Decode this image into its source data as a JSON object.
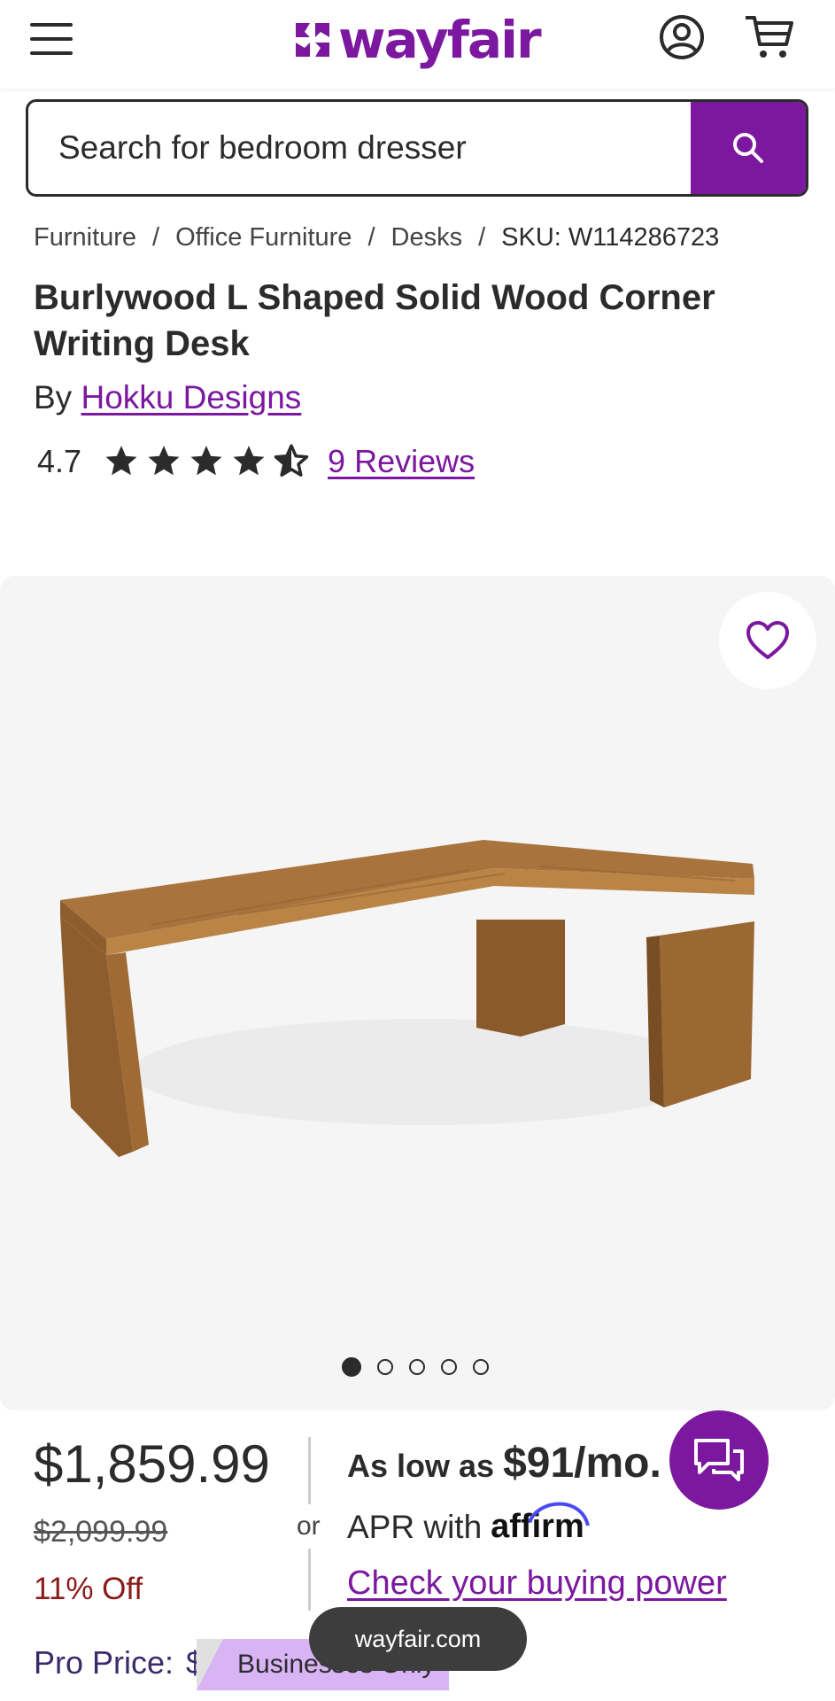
{
  "header": {
    "logo_text": "wayfair",
    "brand_color": "#7b189f",
    "icons": [
      "menu-icon",
      "account-icon",
      "cart-icon"
    ]
  },
  "search": {
    "placeholder": "Search for bedroom dresser"
  },
  "breadcrumb": [
    "Furniture",
    "Office Furniture",
    "Desks",
    "SKU: W114286723"
  ],
  "product": {
    "title": "Burlywood L Shaped Solid Wood Corner Writing Desk",
    "by_label": "By",
    "brand": "Hokku Designs",
    "rating": "4.7",
    "rating_value": 4.7,
    "reviews_label": "9 Reviews"
  },
  "gallery": {
    "image_count": 5,
    "active_index": 0
  },
  "pricing": {
    "price": "$1,859.99",
    "original_price": "$2,099.99",
    "discount": "11% Off",
    "or_label": "or",
    "financing_prefix": "As low as",
    "financing_amount": "$91/mo.",
    "apr_label": "APR with",
    "affirm_label": "affirm",
    "buying_power_link": "Check your buying power",
    "pro_price_label": "Pro Price:",
    "pro_price_partial": "$",
    "business_badge": "Businesses Only"
  },
  "toast": {
    "text": "wayfair.com"
  }
}
